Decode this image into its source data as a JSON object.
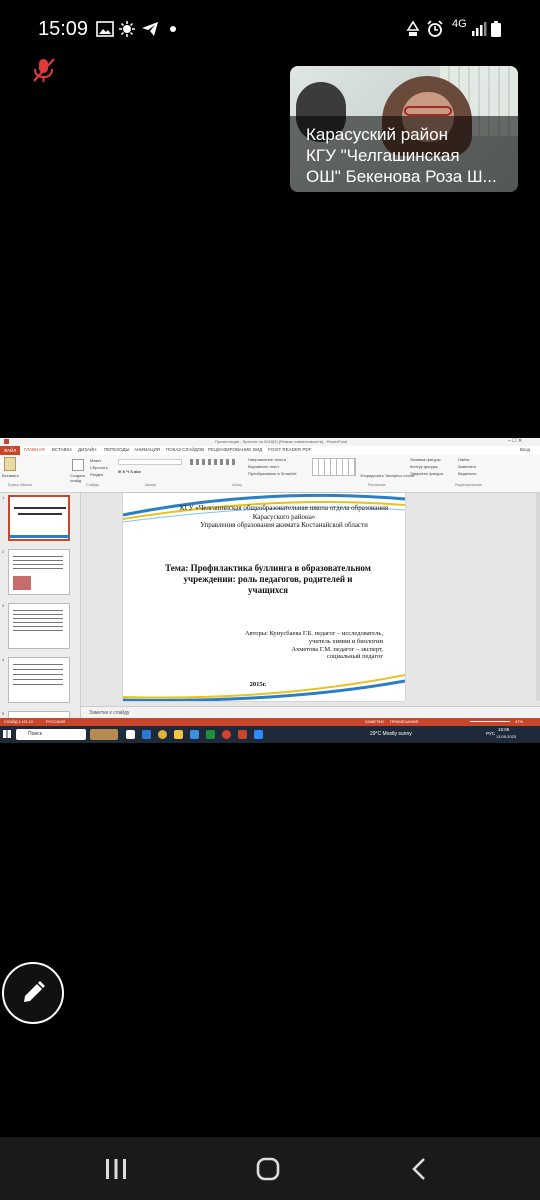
{
  "status_bar": {
    "time": "15:09",
    "network": "4G",
    "icons": [
      "image-icon",
      "weather-icon",
      "telegram-icon",
      "dot-icon",
      "recycle-icon",
      "alarm-icon",
      "signal-icon",
      "battery-icon"
    ]
  },
  "meeting": {
    "mic_state": "muted",
    "participant_name": "Карасуский район\nКГУ \"Челгашинская\nОШ\" Бекенова Роза Ш..."
  },
  "powerpoint": {
    "title_bar": "Презентация - буллинг на 2018(2) [Режим совместимости] - PowerPoint",
    "file_tab": "ФАЙЛ",
    "tabs": [
      "ГЛАВНАЯ",
      "ВСТАВКА",
      "ДИЗАЙН",
      "ПЕРЕХОДЫ",
      "АНИМАЦИЯ",
      "ПОКАЗ СЛАЙДОВ",
      "РЕЦЕНЗИРОВАНИЕ",
      "ВИД",
      "FOXIT READER PDF"
    ],
    "user": "Вход",
    "ribbon_groups": [
      "Буфер обмена",
      "Слайды",
      "Шрифт",
      "Абзац",
      "Рисование",
      "Редактирование"
    ],
    "ribbon_items": {
      "paste": "Вставить",
      "new_slide": "Создать слайд",
      "layout": "Макет",
      "reset": "Сбросить",
      "section": "Раздел",
      "find": "Найти",
      "replace": "Заменить",
      "select": "Выделить",
      "arrange": "Упорядочить",
      "quick_styles": "Экспресс-стили",
      "shape_fill": "Заливка фигуры",
      "shape_outline": "Контур фигуры",
      "shape_effects": "Эффекты фигуры",
      "text_direction": "Направление текста",
      "align_text": "Выровнять текст",
      "smartart": "Преобразовать в SmartArt"
    },
    "thumbnails": [
      "1",
      "2",
      "3",
      "4",
      "5"
    ],
    "slide": {
      "header": "КГУ «Челгашинская общеобразовательная школа отдела образования\nКарасуского района»\nУправления образования акимата Костанайской области",
      "title": "Тема: Профилактика буллинга в образовательном\nучреждении: роль педагогов, родителей и\nучащихся",
      "authors": "Авторы: Кунусбаева Г.Б. педагог – исследователь,\nучитель химии и биологии\nАхметова Г.М. педагог – эксперт,\nсоциальный педагог",
      "year": "2015г."
    },
    "notes_placeholder": "Заметки к слайду",
    "status_left": "СЛАЙД 1 ИЗ 10",
    "language": "РУССКИЙ",
    "notes_btn": "ЗАМЕТКИ",
    "comments_btn": "ПРИМЕЧАНИЯ",
    "zoom": "47%"
  },
  "windows_taskbar": {
    "search_placeholder": "Поиск",
    "weather": "29°C  Mostly sunny",
    "lang": "РУС",
    "time": "15:08",
    "date": "13.09.2023"
  },
  "colors": {
    "ppt_accent": "#c8462b",
    "taskbar": "#1e2a3a",
    "slide_wave_blue": "#2a7fc4",
    "slide_wave_yellow": "#e8c21e"
  },
  "nav": {
    "icons": [
      "recents-icon",
      "home-icon",
      "back-icon"
    ]
  }
}
